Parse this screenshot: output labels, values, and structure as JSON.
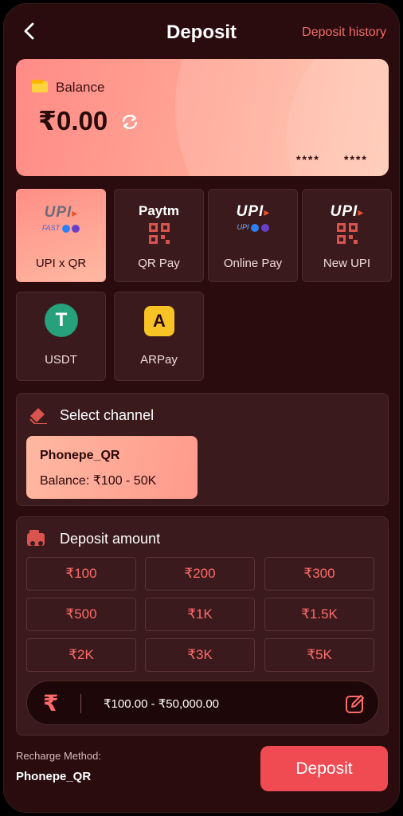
{
  "header": {
    "title": "Deposit",
    "history_link": "Deposit history"
  },
  "balance": {
    "label": "Balance",
    "value": "₹0.00",
    "masked_left": "****",
    "masked_right": "****"
  },
  "methods": [
    {
      "label": "UPI x QR",
      "logo_text": "UPI",
      "active": true
    },
    {
      "label": "QR Pay",
      "logo_text": "Paytm",
      "active": false
    },
    {
      "label": "Online Pay",
      "logo_text": "UPI",
      "active": false
    },
    {
      "label": "New UPI",
      "logo_text": "UPI",
      "active": false
    },
    {
      "label": "USDT",
      "logo_text": "T",
      "active": false
    },
    {
      "label": "ARPay",
      "logo_text": "A",
      "active": false
    }
  ],
  "channel": {
    "title": "Select channel",
    "name": "Phonepe_QR",
    "balance": "Balance: ₹100 - 50K"
  },
  "amount": {
    "title": "Deposit amount",
    "options": [
      "₹100",
      "₹200",
      "₹300",
      "₹500",
      "₹1K",
      "₹1.5K",
      "₹2K",
      "₹3K",
      "₹5K"
    ],
    "currency_symbol": "₹",
    "range": "₹100.00 - ₹50,000.00"
  },
  "footer": {
    "method_label": "Recharge Method:",
    "method_value": "Phonepe_QR",
    "button": "Deposit"
  },
  "colors": {
    "background": "#2a0c0e",
    "accent": "#f04a52",
    "card": "#3a1a1c",
    "amount_text": "#ff6b6b"
  }
}
